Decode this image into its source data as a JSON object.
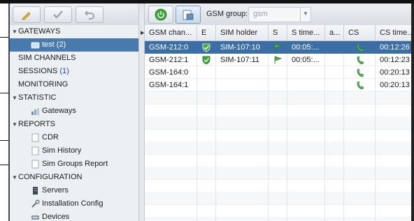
{
  "sidebar": {
    "items": [
      {
        "label": "GATEWAYS",
        "type": "section"
      },
      {
        "label": "test",
        "count": "(2)",
        "type": "child"
      },
      {
        "label": "SIM CHANNELS",
        "type": "plain"
      },
      {
        "label": "SESSIONS",
        "count": "(1)",
        "type": "plain"
      },
      {
        "label": "MONITORING",
        "type": "plain"
      },
      {
        "label": "STATISTIC",
        "type": "section"
      },
      {
        "label": "Gateways",
        "type": "child"
      },
      {
        "label": "REPORTS",
        "type": "section"
      },
      {
        "label": "CDR",
        "type": "child"
      },
      {
        "label": "Sim History",
        "type": "child"
      },
      {
        "label": "Sim Groups Report",
        "type": "child"
      },
      {
        "label": "CONFIGURATION",
        "type": "section"
      },
      {
        "label": "Servers",
        "type": "child"
      },
      {
        "label": "Installation Config",
        "type": "child"
      },
      {
        "label": "Devices",
        "type": "child"
      }
    ]
  },
  "toolbar": {
    "group_label": "GSM group:",
    "group_value": "gsm"
  },
  "table": {
    "columns": [
      "GSM chan...",
      "E",
      "SIM holder",
      "S",
      "S time...",
      "a...",
      "CS",
      "CS time..."
    ],
    "rows": [
      {
        "gsm": "GSM-212:0",
        "e": "check",
        "sim": "SIM-107:10",
        "s": "signal",
        "stime": "00:05:...",
        "a": "",
        "cs": "phone",
        "cstime": "00:12:26",
        "selected": true
      },
      {
        "gsm": "GSM-212:1",
        "e": "check",
        "sim": "SIM-107:11",
        "s": "signal",
        "stime": "00:05:...",
        "a": "",
        "cs": "phone",
        "cstime": "00:12:23",
        "selected": false
      },
      {
        "gsm": "GSM-164:0",
        "e": "",
        "sim": "",
        "s": "",
        "stime": "",
        "a": "",
        "cs": "phone",
        "cstime": "00:20:13",
        "selected": false
      },
      {
        "gsm": "GSM-164:1",
        "e": "",
        "sim": "",
        "s": "",
        "stime": "",
        "a": "",
        "cs": "phone",
        "cstime": "00:20:13",
        "selected": false
      }
    ]
  },
  "colors": {
    "selection": "#3b6ea5",
    "sidebar_bg": "#edf0f3",
    "ok_green": "#3aa63a"
  }
}
